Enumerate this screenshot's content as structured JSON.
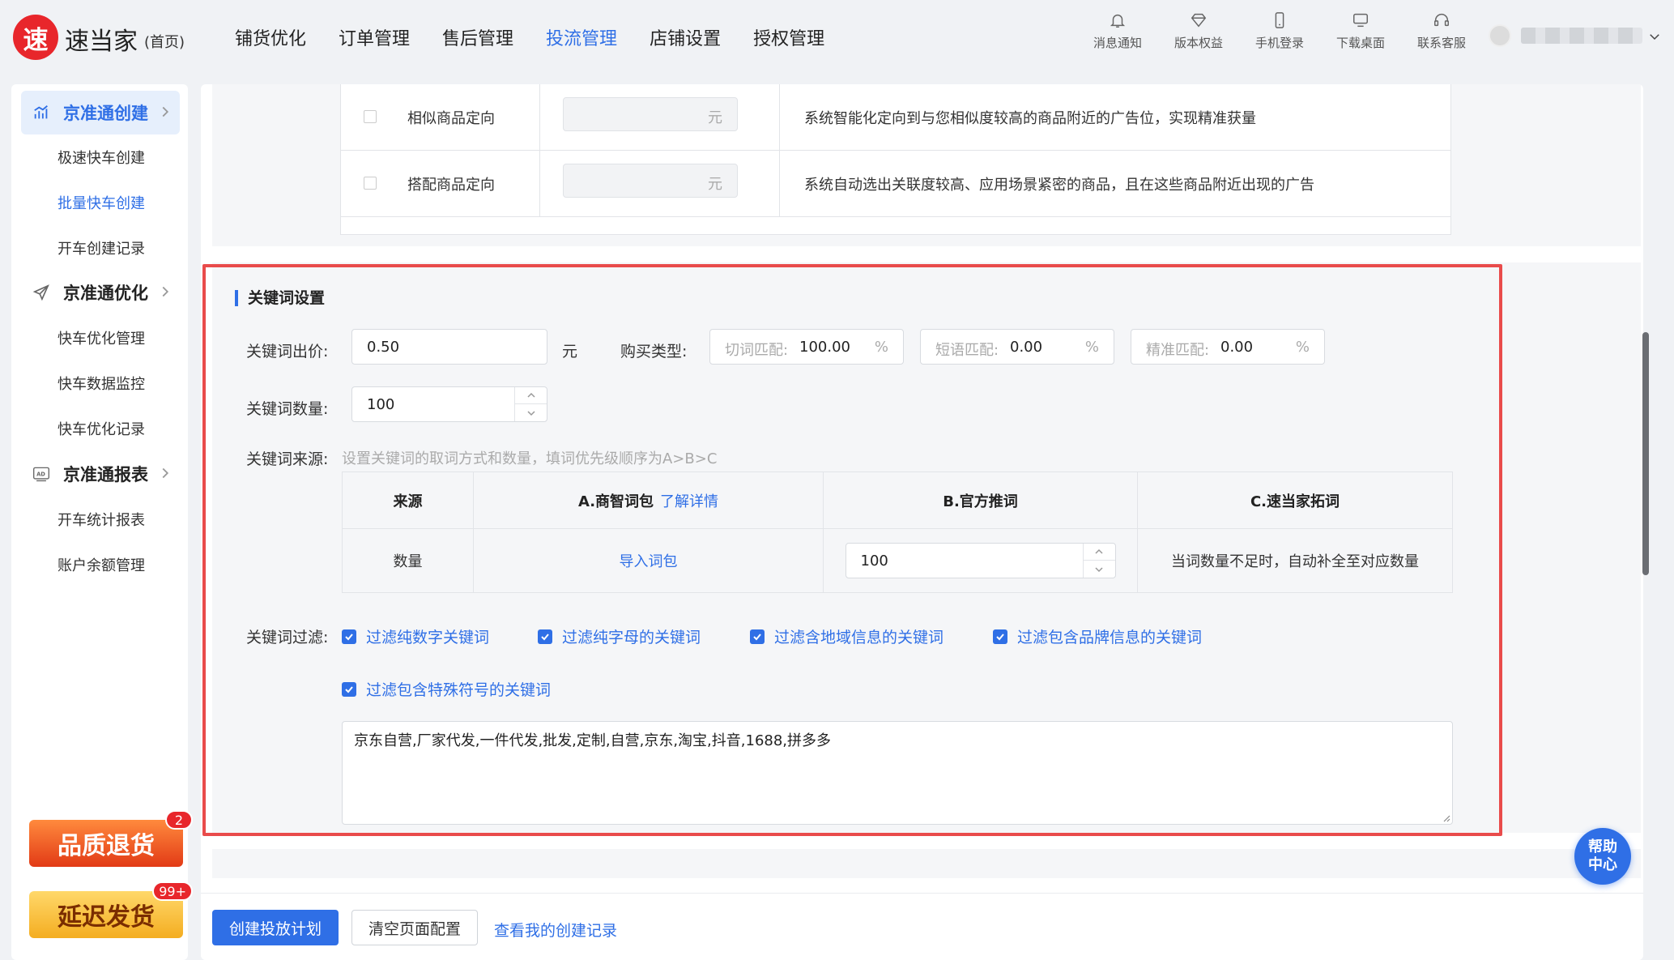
{
  "app": {
    "logo_char": "速",
    "name": "速当家",
    "home": "(首页)"
  },
  "nav": [
    "铺货优化",
    "订单管理",
    "售后管理",
    "投流管理",
    "店铺设置",
    "授权管理"
  ],
  "tools": [
    "消息通知",
    "版本权益",
    "手机登录",
    "下载桌面",
    "联系客服"
  ],
  "sidebar": {
    "groups": [
      {
        "label": "京准通创建",
        "items": [
          "极速快车创建",
          "批量快车创建",
          "开车创建记录"
        ]
      },
      {
        "label": "京准通优化",
        "items": [
          "快车优化管理",
          "快车数据监控",
          "快车优化记录"
        ]
      },
      {
        "label": "京准通报表",
        "items": [
          "开车统计报表",
          "账户余额管理"
        ]
      }
    ],
    "active_item": "批量快车创建",
    "promos": [
      {
        "label": "品质退货",
        "count": "2"
      },
      {
        "label": "延迟发货",
        "count": "99+"
      }
    ]
  },
  "targeting": {
    "rows": [
      {
        "name": "相似商品定向",
        "unit": "元",
        "desc": "系统智能化定向到与您相似度较高的商品附近的广告位，实现精准获量"
      },
      {
        "name": "搭配商品定向",
        "unit": "元",
        "desc": "系统自动选出关联度较高、应用场景紧密的商品，且在这些商品附近出现的广告"
      }
    ]
  },
  "keyword": {
    "title": "关键词设置",
    "bid_label": "关键词出价:",
    "bid_value": "0.50",
    "bid_unit": "元",
    "buy_type_label": "购买类型:",
    "match": [
      {
        "label": "切词匹配:",
        "value": "100.00",
        "unit": "%"
      },
      {
        "label": "短语匹配:",
        "value": "0.00",
        "unit": "%"
      },
      {
        "label": "精准匹配:",
        "value": "0.00",
        "unit": "%"
      }
    ],
    "count_label": "关键词数量:",
    "count_value": "100",
    "source_label": "关键词来源:",
    "source_hint": "设置关键词的取词方式和数量，填词优先级顺序为A>B>C",
    "source_table": {
      "headers": [
        "来源",
        "A.商智词包",
        "B.官方推词",
        "C.速当家拓词"
      ],
      "header_link": "了解详情",
      "row_label": "数量",
      "import_link": "导入词包",
      "official_value": "100",
      "tuoci_note": "当词数量不足时，自动补全至对应数量"
    },
    "filter_label": "关键词过滤:",
    "filters": [
      "过滤纯数字关键词",
      "过滤纯字母的关键词",
      "过滤含地域信息的关键词",
      "过滤包含品牌信息的关键词",
      "过滤包含特殊符号的关键词"
    ],
    "exclude_text": "京东自营,厂家代发,一件代发,批发,定制,自营,京东,淘宝,抖音,1688,拼多多"
  },
  "footer": {
    "create": "创建投放计划",
    "clear": "清空页面配置",
    "records": "查看我的创建记录"
  },
  "help": {
    "line1": "帮助",
    "line2": "中心"
  },
  "colors": {
    "accent": "#2f6fe6",
    "highlight": "#e94b4b",
    "logo": "#e8262b"
  }
}
